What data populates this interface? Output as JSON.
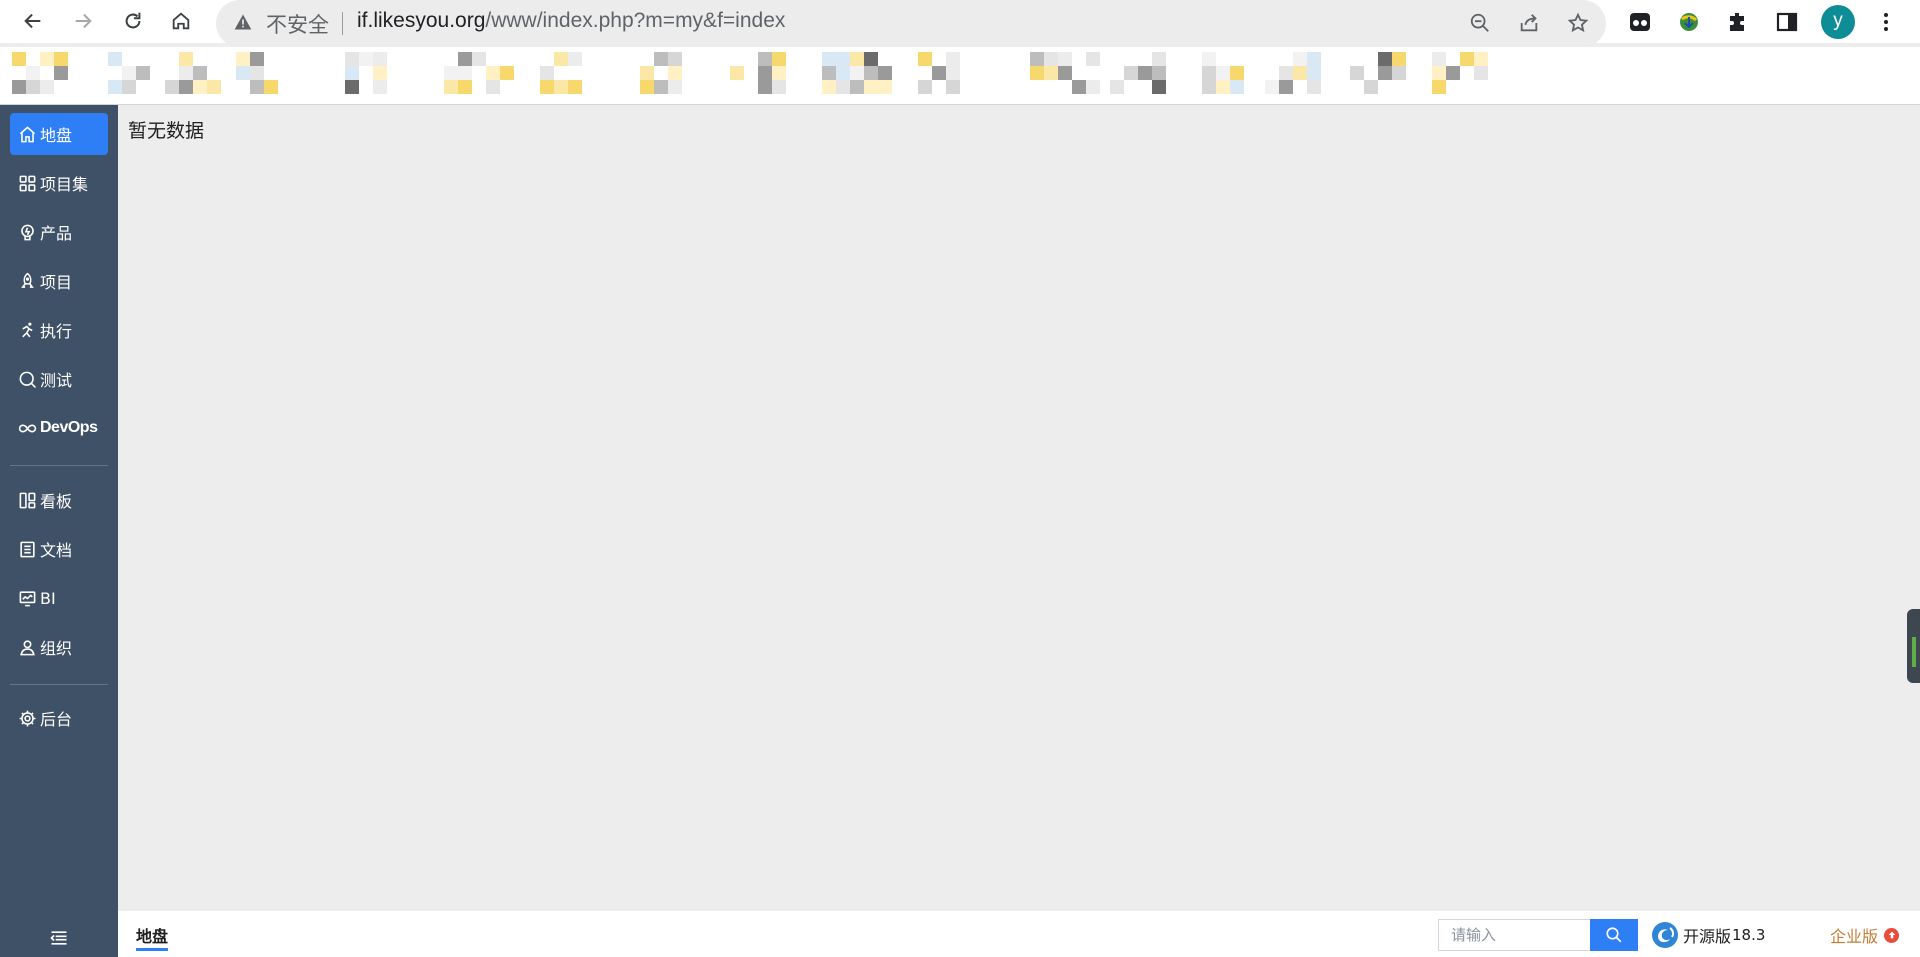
{
  "browser": {
    "insecure_label": "不安全",
    "url_host": "if.likesyou.org",
    "url_path": "/www/index.php?m=my&f=index",
    "avatar_letter": "y",
    "icons": [
      "back-icon",
      "forward-icon",
      "reload-icon",
      "home-icon",
      "warning-icon",
      "zoom-out-icon",
      "share-icon",
      "bookmark-star-icon",
      "extension-icon",
      "puzzle-icon",
      "side-panel-icon",
      "more-icon"
    ]
  },
  "sidebar": {
    "items": [
      {
        "label": "地盘",
        "icon": "home-icon",
        "active": true
      },
      {
        "label": "项目集",
        "icon": "grid-icon",
        "active": false
      },
      {
        "label": "产品",
        "icon": "bulb-icon",
        "active": false
      },
      {
        "label": "项目",
        "icon": "rocket-icon",
        "active": false
      },
      {
        "label": "执行",
        "icon": "running-icon",
        "active": false
      },
      {
        "label": "测试",
        "icon": "magnifier-icon",
        "active": false
      },
      {
        "label": "DevOps",
        "icon": "infinity-icon",
        "active": false
      },
      {
        "label": "看板",
        "icon": "kanban-icon",
        "active": false
      },
      {
        "label": "文档",
        "icon": "document-icon",
        "active": false
      },
      {
        "label": "BI",
        "icon": "monitor-chart-icon",
        "active": false
      },
      {
        "label": "组织",
        "icon": "user-icon",
        "active": false
      },
      {
        "label": "后台",
        "icon": "gear-icon",
        "active": false
      }
    ]
  },
  "main": {
    "empty_text": "暂无数据"
  },
  "footer": {
    "tab_label": "地盘",
    "search_placeholder": "请输入",
    "brand_name": "开源版",
    "brand_version": "18.3",
    "enterprise_label": "企业版"
  },
  "colors": {
    "sidebar_bg": "#3f5167",
    "accent": "#2e7ff5",
    "enterprise": "#c57d35",
    "avatar": "#0f8d97"
  }
}
